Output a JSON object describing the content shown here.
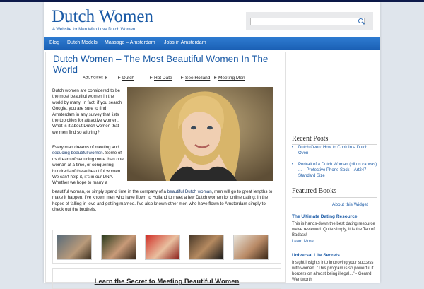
{
  "site": {
    "title": "Dutch Women",
    "tagline": "A Website for Men Who Love Dutch Women"
  },
  "search": {
    "placeholder": ""
  },
  "nav": {
    "items": [
      "Blog",
      "Dutch Models",
      "Massage – Amsterdam",
      "Jobs in Amsterdam"
    ]
  },
  "post": {
    "title": "Dutch Women – The Most Beautiful Women In The World",
    "adchoices": "AdChoices",
    "ad_links": [
      "Dutch",
      "Hot Date",
      "See Holland",
      "Meeting Men"
    ],
    "p1": "Dutch women are considered to be the most beautiful women in the world by many. In fact, if you search Google, you are sure to find Amsterdam in any survey that lists the top cities for attractive women. What is it about Dutch women that we men find so alluring?",
    "p2_a": "Every man dreams of meeting and",
    "p2_link": "seducing beautiful women",
    "p2_b": ". Some of us dream of seducing more than one woman at a time, or conquering hundreds of these beautiful women. We can't help it, it's in our DNA. Whether we hope to marry a",
    "p3_a": "beautiful woman, or simply spend time in the company of a",
    "p3_link": "beautiful Dutch woman",
    "p3_b": ", men will go to great lengths to make it happen. I've known men who have flown to Holland to meet a few Dutch women for online dating; in the hopes of falling in love and getting married. I've also known other men who have flown to Amsterdam simply to check out the brothels.",
    "secret_link": "Learn the Secret to Meeting Beautiful Women"
  },
  "sidebar": {
    "recent_heading": "Recent Posts",
    "recent_posts": [
      "Dutch Oven: How to Cook In a Dutch Oven",
      "Portrait of a Dutch Woman (oil on canvas) ... – Protective Phone Sock – Art247 – Standard Size"
    ],
    "featured_heading": "Featured Books",
    "about_widget": "About this Widget",
    "books": [
      {
        "title": "The Ultimate Dating Resource",
        "desc": "This is hands-down the best dating resource we've reviewed. Quite simply, it is the Tao of Badass!",
        "learn": "Learn More"
      },
      {
        "title": "Universal Life Secrets",
        "desc": "Insight insights into improving your success with women. \"This program is so powerful it borders on almost being illegal...\" - Gerard Wentworth"
      }
    ]
  },
  "colors": {
    "brand": "#1a5aa6",
    "nav_bar": "#1f67bd",
    "page_background": "#dfe5ec"
  }
}
